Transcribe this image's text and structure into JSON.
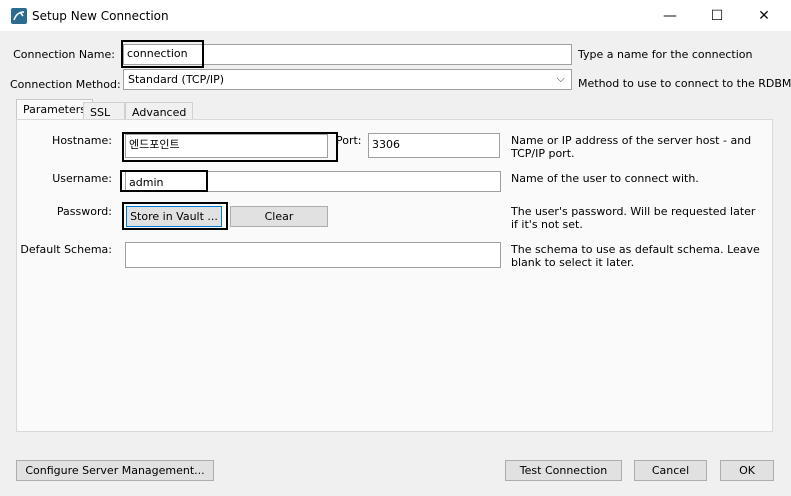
{
  "window": {
    "title": "Setup New Connection",
    "minimize_glyph": "—",
    "maximize_glyph": "☐",
    "close_glyph": "✕"
  },
  "connection_name": {
    "label": "Connection Name:",
    "value": "connection",
    "help": "Type a name for the connection"
  },
  "connection_method": {
    "label": "Connection Method:",
    "value": "Standard (TCP/IP)",
    "help": "Method to use to connect to the RDBMS"
  },
  "tabs": [
    {
      "label": "Parameters"
    },
    {
      "label": "SSL"
    },
    {
      "label": "Advanced"
    }
  ],
  "parameters": {
    "hostname": {
      "label": "Hostname:",
      "value": "엔드포인트",
      "help": "Name or IP address of the server host - and TCP/IP port."
    },
    "port": {
      "label": "Port:",
      "value": "3306"
    },
    "username": {
      "label": "Username:",
      "value": "admin",
      "help": "Name of the user to connect with."
    },
    "password": {
      "label": "Password:",
      "store_button": "Store in Vault ...",
      "clear_button": "Clear",
      "help": "The user's password. Will be requested later if it's not set."
    },
    "default_schema": {
      "label": "Default Schema:",
      "value": "",
      "help": "The schema to use as default schema. Leave blank to select it later."
    }
  },
  "footer": {
    "configure_button": "Configure Server Management...",
    "test_button": "Test Connection",
    "cancel_button": "Cancel",
    "ok_button": "OK"
  }
}
